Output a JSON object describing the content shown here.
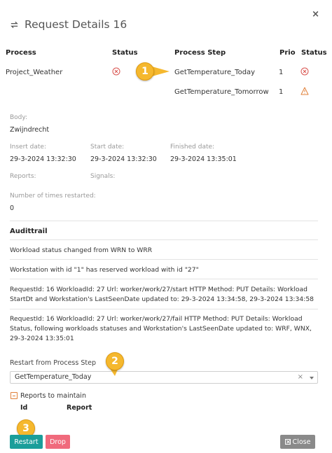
{
  "dialog": {
    "title": "Request Details 16",
    "close_glyph": "×"
  },
  "table": {
    "headers": {
      "process": "Process",
      "status": "Status",
      "process_step": "Process Step",
      "prio": "Prio",
      "step_status": "Status"
    },
    "process_name": "Project_Weather",
    "process_status": "error",
    "steps": [
      {
        "name": "GetTemperature_Today",
        "prio": "1",
        "status": "error"
      },
      {
        "name": "GetTemperature_Tomorrow",
        "prio": "1",
        "status": "warning"
      }
    ]
  },
  "details": {
    "body_label": "Body:",
    "body_value": "Zwijndrecht",
    "insert_label": "Insert date:",
    "insert_value": "29-3-2024 13:32:30",
    "start_label": "Start date:",
    "start_value": "29-3-2024 13:32:30",
    "finished_label": "Finished date:",
    "finished_value": "29-3-2024 13:35:01",
    "reports_label": "Reports:",
    "signals_label": "Signals:",
    "restarted_label": "Number of times restarted:",
    "restarted_value": "0"
  },
  "audittrail": {
    "title": "Audittrail",
    "entries": [
      "Workload status changed from WRN to WRR",
      "Workstation with id \"1\" has reserved workload with id \"27\"",
      "RequestId: 16 WorkloadId: 27 Url: worker/work/27/start HTTP Method: PUT Details: Workload StartDt and Workstation's LastSeenDate updated to: 29-3-2024 13:34:58, 29-3-2024 13:34:58",
      "RequestId: 16 WorkloadId: 27 Url: worker/work/27/fail HTTP Method: PUT Details: Workload Status, following workloads statuses and Workstation's LastSeenDate updated to: WRF, WNX, 29-3-2024 13:35:01"
    ]
  },
  "restart": {
    "label": "Restart from Process Step",
    "selected": "GetTemperature_Today",
    "clear_glyph": "×"
  },
  "reports": {
    "label": "Reports to maintain",
    "col_id": "Id",
    "col_report": "Report"
  },
  "buttons": {
    "restart": "Restart",
    "drop": "Drop",
    "close": "Close"
  },
  "callouts": {
    "one": "1",
    "two": "2",
    "three": "3"
  },
  "colors": {
    "teal": "#1a9e9a",
    "pink": "#f06a7c",
    "grey": "#8a8a8a",
    "badge": "#f5b82e",
    "error": "#d9534f",
    "warning": "#e0803a"
  }
}
